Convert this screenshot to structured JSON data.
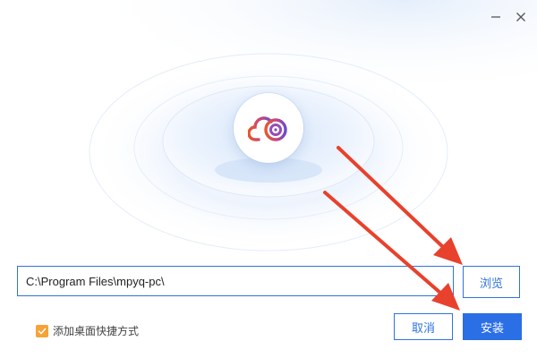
{
  "window": {
    "minimize_icon": "minimize-icon",
    "close_icon": "close-icon"
  },
  "logo": {
    "icon": "cloud-disc-logo-icon",
    "colors": [
      "#e7562c",
      "#b04aa0",
      "#6b4cc6"
    ]
  },
  "install_path": {
    "value": "C:\\Program Files\\mpyq-pc\\"
  },
  "buttons": {
    "browse_label": "浏览",
    "cancel_label": "取消",
    "install_label": "安装"
  },
  "shortcut": {
    "label": "添加桌面快捷方式",
    "checked": true
  },
  "colors": {
    "accent": "#2b6fe6",
    "checkbox": "#f7a235",
    "annotation_arrow": "#e8412c"
  }
}
